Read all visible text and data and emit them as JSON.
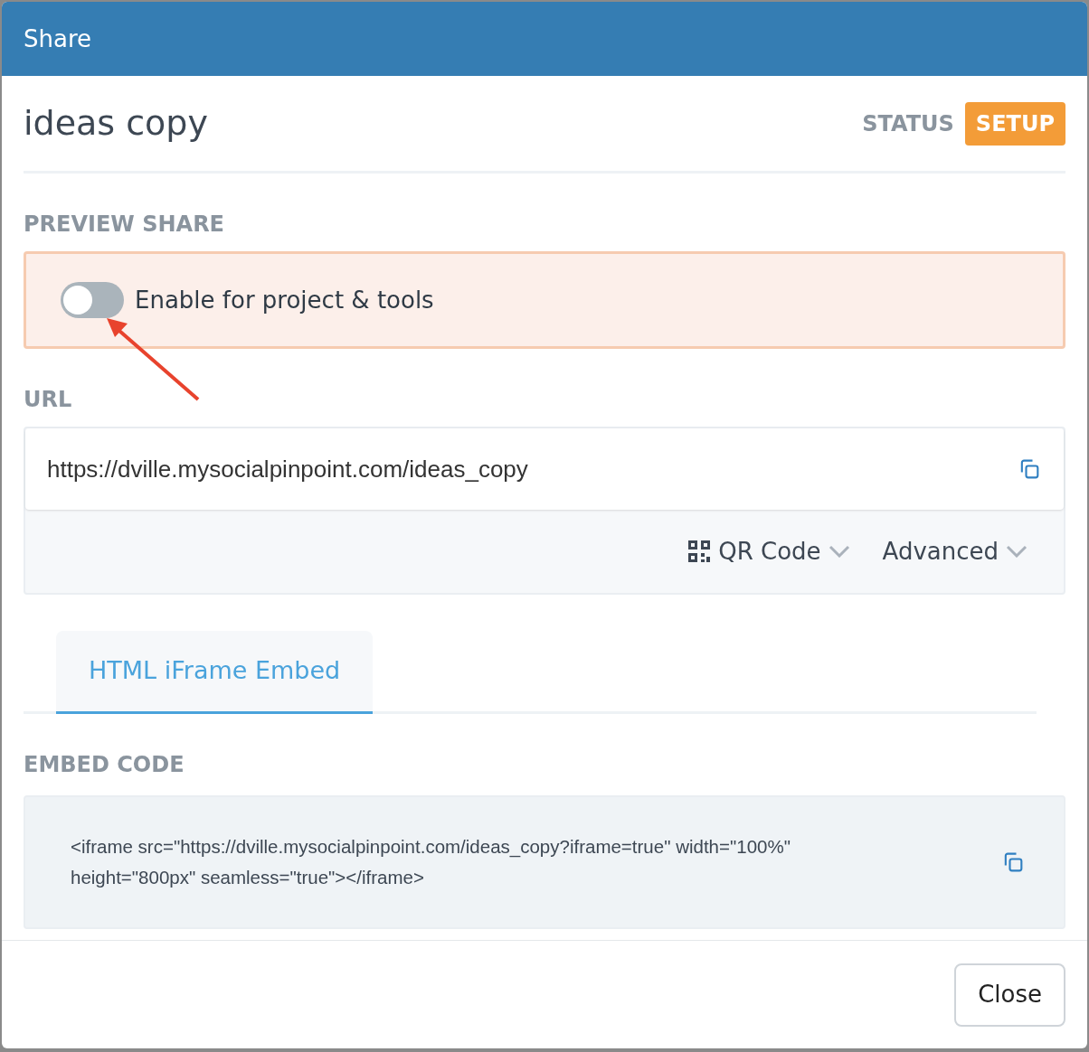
{
  "window": {
    "title": "Share"
  },
  "header": {
    "title": "ideas copy",
    "status_label": "STATUS",
    "status_badge": "SETUP"
  },
  "preview_share": {
    "heading": "PREVIEW SHARE",
    "toggle": {
      "label": "Enable for project & tools",
      "on": false
    }
  },
  "url": {
    "heading": "URL",
    "value": "https://dville.mysocialpinpoint.com/ideas_copy",
    "options": [
      {
        "kind": "qr",
        "label": "QR Code"
      },
      {
        "kind": "plain",
        "label": "Advanced"
      }
    ]
  },
  "tabs": [
    {
      "label": "HTML iFrame Embed",
      "selected": true
    }
  ],
  "embed": {
    "heading": "EMBED CODE",
    "code": "<iframe src=\"https://dville.mysocialpinpoint.com/ideas_copy?iframe=true\" width=\"100%\" height=\"800px\" seamless=\"true\"></iframe>"
  },
  "buttons": [
    "Close"
  ]
}
